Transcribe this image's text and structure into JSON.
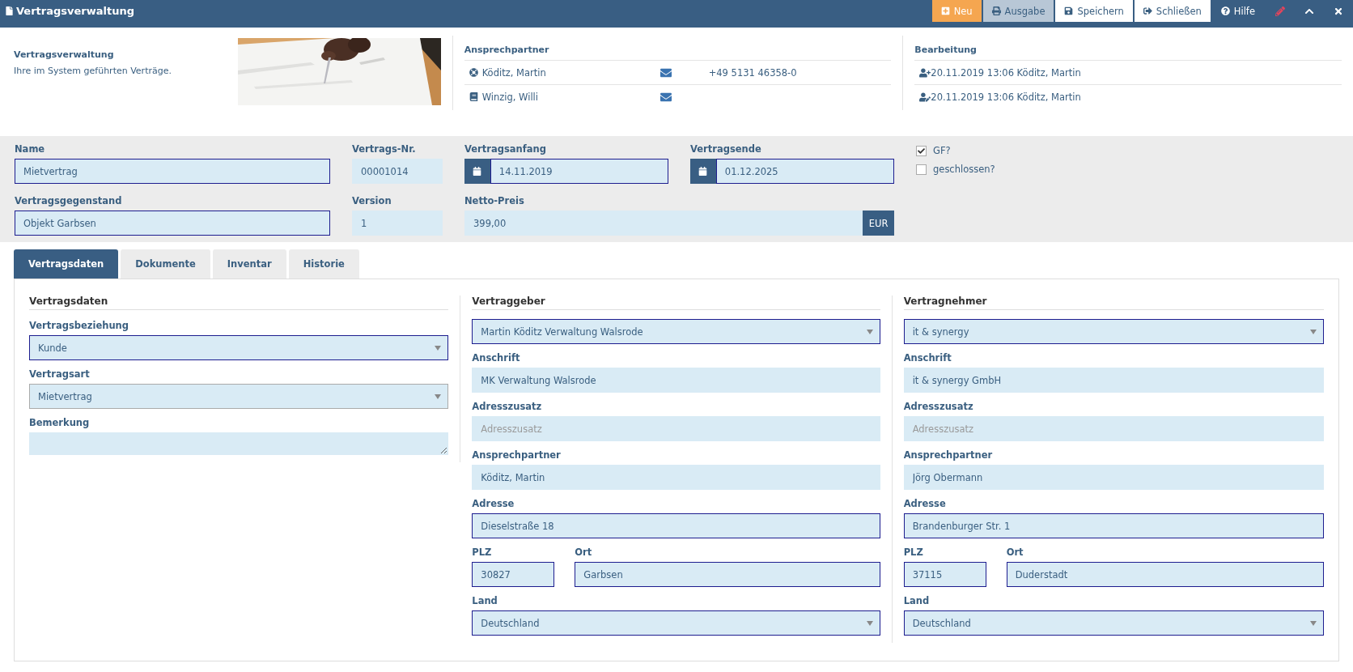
{
  "topbar": {
    "title": "Vertragsverwaltung",
    "buttons": [
      {
        "kind": "new",
        "label": "Neu"
      },
      {
        "kind": "print",
        "label": "Ausgabe"
      },
      {
        "kind": "save",
        "label": "Speichern"
      },
      {
        "kind": "exit",
        "label": "Schließen"
      },
      {
        "kind": "help",
        "label": "Hilfe"
      }
    ],
    "icon_buttons": [
      {
        "kind": "edit"
      },
      {
        "kind": "collapse"
      },
      {
        "kind": "close"
      }
    ]
  },
  "header": {
    "title": "Vertragsverwaltung",
    "description": "Ihre im System geführten Verträge.",
    "contacts": {
      "heading": "Ansprechpartner",
      "rows": [
        {
          "kind": "support",
          "name": "Köditz, Martin",
          "phone": "+49 5131 46358-0"
        },
        {
          "kind": "book",
          "name": "Winzig, Willi"
        }
      ]
    },
    "edits": {
      "heading": "Bearbeitung",
      "rows": [
        {
          "kind": "created",
          "text": "20.11.2019 13:06 Köditz, Martin"
        },
        {
          "kind": "modified",
          "text": "20.11.2019 13:06 Köditz, Martin"
        }
      ]
    }
  },
  "form": {
    "fields": [
      {
        "kind": "text",
        "label": "Name",
        "value": "Mietvertrag",
        "highlighted": true
      },
      {
        "kind": "text",
        "label": "Vertrags-Nr.",
        "value": "00001014",
        "highlighted": false
      },
      {
        "kind": "date",
        "label": "Vertragsanfang",
        "value": "14.11.2019",
        "highlighted": true
      },
      {
        "kind": "date",
        "label": "Vertragsende",
        "value": "01.12.2025",
        "highlighted": true
      },
      {
        "kind": "text",
        "label": "Vertragsgegenstand",
        "value": "Objekt Garbsen",
        "highlighted": true
      },
      {
        "kind": "text",
        "label": "Version",
        "value": "1",
        "highlighted": false
      },
      {
        "kind": "currency",
        "label": "Netto-Preis",
        "value": "399,00",
        "addon": "EUR",
        "highlighted": false
      }
    ],
    "checkboxes": [
      {
        "label": "GF?",
        "checked": true
      },
      {
        "label": "geschlossen?",
        "checked": false
      }
    ]
  },
  "tabs": [
    {
      "label": "Vertragsdaten",
      "selected": true
    },
    {
      "label": "Dokumente",
      "selected": false
    },
    {
      "label": "Inventar",
      "selected": false
    },
    {
      "label": "Historie",
      "selected": false
    }
  ],
  "columns": [
    {
      "heading": "Vertragsdaten",
      "fields": [
        {
          "kind": "select",
          "label": "Vertragsbeziehung",
          "value": "Kunde",
          "highlighted": true
        },
        {
          "kind": "select",
          "label": "Vertragsart",
          "value": "Mietvertrag",
          "highlighted": false
        },
        {
          "kind": "textarea",
          "label": "Bemerkung",
          "highlighted": false
        }
      ]
    },
    {
      "heading": "Vertraggeber",
      "fields": [
        {
          "kind": "select",
          "value": "Martin Köditz Verwaltung Walsrode",
          "highlighted": true
        },
        {
          "kind": "text",
          "label": "Anschrift",
          "value": "MK Verwaltung Walsrode",
          "highlighted": false
        },
        {
          "kind": "text",
          "label": "Adresszusatz",
          "placeholder": "Adresszusatz",
          "highlighted": false
        },
        {
          "kind": "text",
          "label": "Ansprechpartner",
          "value": "Köditz, Martin",
          "highlighted": false
        },
        {
          "kind": "text",
          "label": "Adresse",
          "value": "Dieselstraße 18",
          "highlighted": true
        },
        {
          "kind": "pair",
          "fields": [
            {
              "kind": "text",
              "label": "PLZ",
              "value": "30827",
              "highlighted": true
            },
            {
              "kind": "text",
              "label": "Ort",
              "value": "Garbsen",
              "highlighted": true
            }
          ]
        },
        {
          "kind": "select",
          "label": "Land",
          "value": "Deutschland",
          "highlighted": true
        }
      ]
    },
    {
      "heading": "Vertragnehmer",
      "fields": [
        {
          "kind": "select",
          "value": "it & synergy",
          "highlighted": true
        },
        {
          "kind": "text",
          "label": "Anschrift",
          "value": "it & synergy GmbH",
          "highlighted": false
        },
        {
          "kind": "text",
          "label": "Adresszusatz",
          "placeholder": "Adresszusatz",
          "highlighted": false
        },
        {
          "kind": "text",
          "label": "Ansprechpartner",
          "value": "Jörg Obermann",
          "highlighted": false
        },
        {
          "kind": "text",
          "label": "Adresse",
          "value": "Brandenburger Str. 1",
          "highlighted": true
        },
        {
          "kind": "pair",
          "fields": [
            {
              "kind": "text",
              "label": "PLZ",
              "value": "37115",
              "highlighted": true
            },
            {
              "kind": "text",
              "label": "Ort",
              "value": "Duderstadt",
              "highlighted": true
            }
          ]
        },
        {
          "kind": "select",
          "label": "Land",
          "value": "Deutschland",
          "highlighted": true
        }
      ]
    }
  ]
}
